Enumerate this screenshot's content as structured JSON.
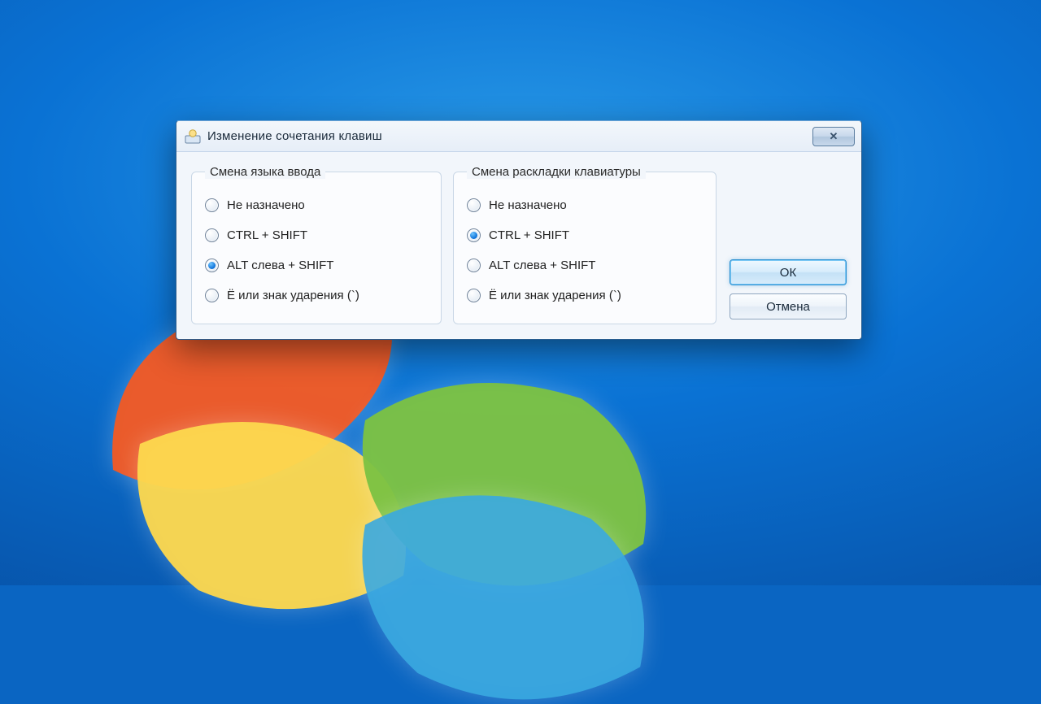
{
  "window": {
    "title": "Изменение сочетания клавиш"
  },
  "groups": {
    "left": {
      "legend": "Смена языка ввода",
      "options": [
        {
          "label": "Не назначено",
          "checked": false
        },
        {
          "label": "CTRL + SHIFT",
          "checked": false
        },
        {
          "label": "ALT слева + SHIFT",
          "checked": true
        },
        {
          "label": "Ё или знак ударения (`)",
          "checked": false
        }
      ]
    },
    "right": {
      "legend": "Смена раскладки клавиатуры",
      "options": [
        {
          "label": "Не назначено",
          "checked": false
        },
        {
          "label": "CTRL + SHIFT",
          "checked": true
        },
        {
          "label": "ALT слева + SHIFT",
          "checked": false
        },
        {
          "label": "Ё или знак ударения (`)",
          "checked": false
        }
      ]
    }
  },
  "buttons": {
    "ok": "ОК",
    "cancel": "Отмена"
  }
}
